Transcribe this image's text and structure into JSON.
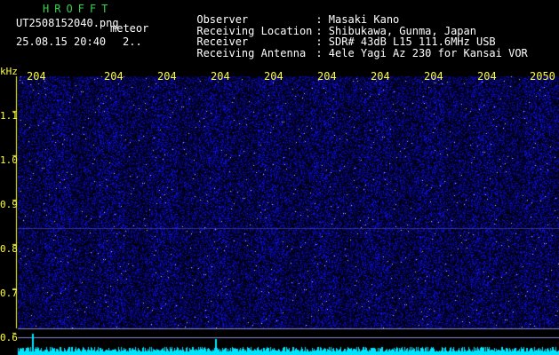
{
  "header": {
    "title": "HROFFT",
    "filename": "UT2508152040.png",
    "tag": "meteor",
    "datetime": "25.08.15 20:40",
    "counter": "2.."
  },
  "meta": [
    {
      "key": "Observer",
      "value": ": Masaki Kano"
    },
    {
      "key": "Receiving Location",
      "value": ": Shibukawa, Gunma, Japan"
    },
    {
      "key": "Receiver",
      "value": ": SDR# 43dB L15 111.6MHz USB"
    },
    {
      "key": "Receiving Antenna",
      "value": ": 4ele Yagi Az 230 for Kansai VOR"
    }
  ],
  "axis": {
    "unit": "kHz",
    "y_ticks": [
      "1.1",
      "1.0",
      "0.9",
      "0.8",
      "0.7",
      "0.6"
    ],
    "x_ticks": [
      "204",
      "204",
      "204",
      "204",
      "204",
      "204",
      "204",
      "204",
      "204",
      "2050"
    ]
  },
  "colors": {
    "background": "#000000",
    "noise": "#1a1aff",
    "title": "#32d24a",
    "axis": "#ffff33",
    "spectrum": "#00e5ff"
  }
}
